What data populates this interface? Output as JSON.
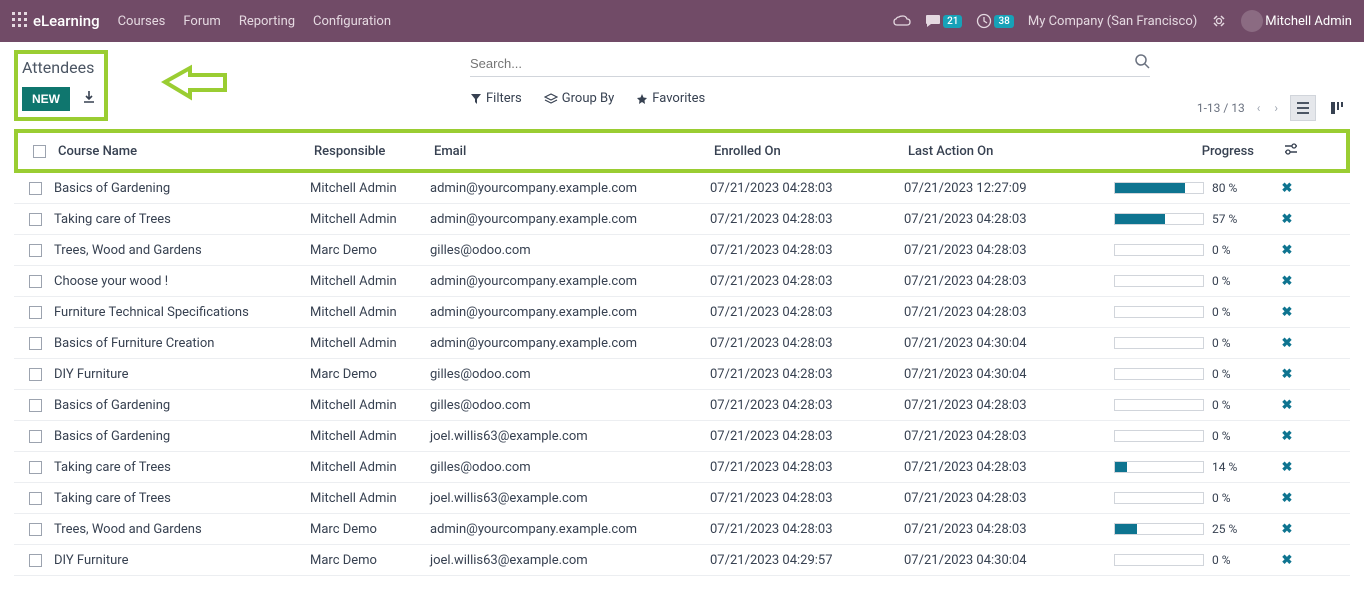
{
  "topbar": {
    "app_name": "eLearning",
    "nav": [
      "Courses",
      "Forum",
      "Reporting",
      "Configuration"
    ],
    "chat_badge": "21",
    "timer_badge": "38",
    "company": "My Company (San Francisco)",
    "user": "Mitchell Admin"
  },
  "header": {
    "breadcrumb": "Attendees",
    "new_label": "NEW"
  },
  "search": {
    "placeholder": "Search...",
    "filters_label": "Filters",
    "group_by_label": "Group By",
    "favorites_label": "Favorites",
    "pager_text": "1-13 / 13"
  },
  "columns": {
    "course": "Course Name",
    "responsible": "Responsible",
    "email": "Email",
    "enrolled": "Enrolled On",
    "lastaction": "Last Action On",
    "progress": "Progress"
  },
  "rows": [
    {
      "course": "Basics of Gardening",
      "responsible": "Mitchell Admin",
      "email": "admin@yourcompany.example.com",
      "enrolled": "07/21/2023 04:28:03",
      "lastaction": "07/21/2023 12:27:09",
      "progress": 80
    },
    {
      "course": "Taking care of Trees",
      "responsible": "Mitchell Admin",
      "email": "admin@yourcompany.example.com",
      "enrolled": "07/21/2023 04:28:03",
      "lastaction": "07/21/2023 04:28:03",
      "progress": 57
    },
    {
      "course": "Trees, Wood and Gardens",
      "responsible": "Marc Demo",
      "email": "gilles@odoo.com",
      "enrolled": "07/21/2023 04:28:03",
      "lastaction": "07/21/2023 04:28:03",
      "progress": 0
    },
    {
      "course": "Choose your wood !",
      "responsible": "Mitchell Admin",
      "email": "admin@yourcompany.example.com",
      "enrolled": "07/21/2023 04:28:03",
      "lastaction": "07/21/2023 04:28:03",
      "progress": 0
    },
    {
      "course": "Furniture Technical Specifications",
      "responsible": "Mitchell Admin",
      "email": "admin@yourcompany.example.com",
      "enrolled": "07/21/2023 04:28:03",
      "lastaction": "07/21/2023 04:28:03",
      "progress": 0
    },
    {
      "course": "Basics of Furniture Creation",
      "responsible": "Mitchell Admin",
      "email": "admin@yourcompany.example.com",
      "enrolled": "07/21/2023 04:28:03",
      "lastaction": "07/21/2023 04:30:04",
      "progress": 0
    },
    {
      "course": "DIY Furniture",
      "responsible": "Marc Demo",
      "email": "gilles@odoo.com",
      "enrolled": "07/21/2023 04:28:03",
      "lastaction": "07/21/2023 04:30:04",
      "progress": 0
    },
    {
      "course": "Basics of Gardening",
      "responsible": "Mitchell Admin",
      "email": "gilles@odoo.com",
      "enrolled": "07/21/2023 04:28:03",
      "lastaction": "07/21/2023 04:28:03",
      "progress": 0
    },
    {
      "course": "Basics of Gardening",
      "responsible": "Mitchell Admin",
      "email": "joel.willis63@example.com",
      "enrolled": "07/21/2023 04:28:03",
      "lastaction": "07/21/2023 04:28:03",
      "progress": 0
    },
    {
      "course": "Taking care of Trees",
      "responsible": "Mitchell Admin",
      "email": "gilles@odoo.com",
      "enrolled": "07/21/2023 04:28:03",
      "lastaction": "07/21/2023 04:28:03",
      "progress": 14
    },
    {
      "course": "Taking care of Trees",
      "responsible": "Mitchell Admin",
      "email": "joel.willis63@example.com",
      "enrolled": "07/21/2023 04:28:03",
      "lastaction": "07/21/2023 04:28:03",
      "progress": 0
    },
    {
      "course": "Trees, Wood and Gardens",
      "responsible": "Marc Demo",
      "email": "admin@yourcompany.example.com",
      "enrolled": "07/21/2023 04:28:03",
      "lastaction": "07/21/2023 04:28:03",
      "progress": 25
    },
    {
      "course": "DIY Furniture",
      "responsible": "Marc Demo",
      "email": "joel.willis63@example.com",
      "enrolled": "07/21/2023 04:29:57",
      "lastaction": "07/21/2023 04:30:04",
      "progress": 0
    }
  ]
}
